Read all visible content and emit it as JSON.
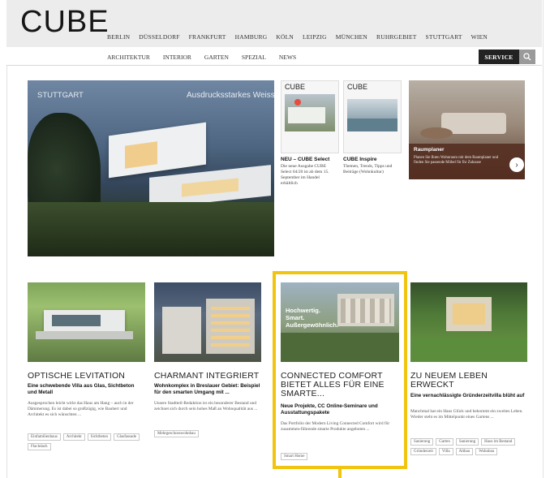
{
  "logo": "CUBE",
  "cities": [
    "BERLIN",
    "DÜSSELDORF",
    "FRANKFURT",
    "HAMBURG",
    "KÖLN",
    "LEIPZIG",
    "MÜNCHEN",
    "RUHRGEBIET",
    "STUTTGART",
    "WIEN"
  ],
  "topics": [
    "ARCHITEKTUR",
    "INTERIOR",
    "GARTEN",
    "SPEZIAL",
    "NEWS"
  ],
  "service_label": "SERVICE",
  "hero": {
    "city": "STUTTGART",
    "tagline": "Ausdrucksstarkes Weiss"
  },
  "magazines": [
    {
      "cover_title": "CUBE",
      "title": "NEU – CUBE Select",
      "text": "Die neue Ausgabe CUBE Select 04/20 ist ab dem 15. September im Handel erhältlich"
    },
    {
      "cover_title": "CUBE",
      "title": "CUBE Inspire",
      "text": "Themen, Trends, Tipps und Beiträge (Wohnkultur)"
    }
  ],
  "promo": {
    "title": "Raumplaner",
    "text": "Planen Sie Ihren Wohnraum mit dem Raumplaner und finden Sie passende Möbel für Ihr Zuhause"
  },
  "articles": [
    {
      "title": "OPTISCHE LEVITATION",
      "subtitle": "Eine schwebende Villa aus Glas, Sichtbeton und Metall",
      "body": "Ausgesprochen leicht wirkt das Haus am Hang – auch in der Dämmerung. Es ist dabei so großzügig, wie Bauherr und Architekt es sich wünschten ...",
      "tags": [
        "Einfamilienhaus",
        "Architekt",
        "Sichtbeton",
        "Glasfassade",
        "Flachdach"
      ]
    },
    {
      "title": "CHARMANT INTEGRIERT",
      "subtitle": "Wohnkomplex in Breslauer Gebiet: Beispiel für den smarten Umgang mit ...",
      "body": "Unsere Stadtteil-Redaktion ist ein besonderer Bestand und zeichnet sich durch sein hohes Maß an Wohnqualität aus ...",
      "tags": [
        "Mehrgeschosswohnbau"
      ]
    },
    {
      "title": "CONNECTED COMFORT BIETET ALLES FÜR EINE SMARTE...",
      "subtitle": "Neue Projekte, CC Online-Seminare und Ausstattungspakete",
      "body": "Das Portfolio der Modern Living Connected Comfort wird für zusammen-führende smarte Produkte angeboten ...",
      "tags": [
        "Smart Home"
      ],
      "image_overlay": [
        "Hochwertig.",
        "Smart.",
        "Außergewöhnlich."
      ]
    },
    {
      "title": "ZU NEUEM LEBEN ERWECKT",
      "subtitle": "Eine vernachlässigte Gründerzeitvilla blüht auf",
      "body": "Manchmal hat ein Haus Glück und bekommt ein zweites Leben. Wieder steht es im Mittelpunkt eines Gartens ...",
      "tags": [
        "Sanierung",
        "Garten",
        "Sanierung",
        "Haus im Bestand",
        "Gründerzeit",
        "Villa",
        "Altbau",
        "Wohnbau"
      ]
    }
  ],
  "colors": {
    "highlight": "#f1c40f",
    "header_bg": "#ececec",
    "service_bg": "#222222"
  }
}
